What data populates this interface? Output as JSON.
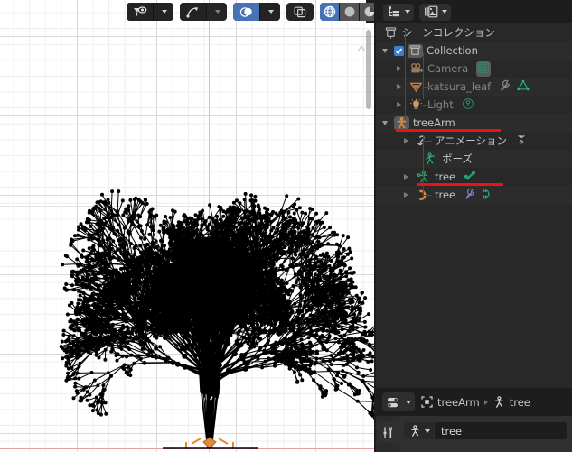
{
  "app": "blender",
  "viewport": {
    "name": "3d-viewport",
    "shading_mode": "wireframe",
    "header_groups": [
      {
        "name": "visibility-group",
        "buttons": [
          {
            "name": "object-type-visibility-icon",
            "label": "",
            "state": "normal"
          },
          {
            "name": "object-type-visibility-dropdown",
            "label": "",
            "state": "normal"
          }
        ]
      },
      {
        "name": "gizmo-group",
        "buttons": [
          {
            "name": "show-gizmo-icon",
            "label": "",
            "state": "normal"
          },
          {
            "name": "gizmo-dropdown",
            "label": "",
            "state": "disabled"
          }
        ]
      },
      {
        "name": "overlay-group",
        "buttons": [
          {
            "name": "show-overlays-icon",
            "label": "",
            "state": "active"
          },
          {
            "name": "overlays-dropdown",
            "label": "",
            "state": "normal"
          }
        ]
      },
      {
        "name": "xray-group",
        "buttons": [
          {
            "name": "toggle-xray-icon",
            "label": "",
            "state": "normal"
          }
        ]
      },
      {
        "name": "shading-group",
        "buttons": [
          {
            "name": "shading-wireframe-icon",
            "label": "",
            "state": "active"
          },
          {
            "name": "shading-solid-icon",
            "label": "",
            "state": "normal"
          },
          {
            "name": "shading-material-preview-icon",
            "label": "",
            "state": "normal"
          },
          {
            "name": "shading-rendered-icon",
            "label": "",
            "state": "normal"
          },
          {
            "name": "shading-dropdown",
            "label": "",
            "state": "normal"
          }
        ]
      }
    ],
    "axis_colors": {
      "z_axis": "#b6cde0",
      "x_axis": "#e6a2a2"
    },
    "background": "#ffffff",
    "grid_minor": "#eeeeee",
    "grid_major": "#d8d8d8",
    "object_color": "#000000",
    "bone_origin_color": "#e08a3c"
  },
  "outliner": {
    "name": "outliner-editor",
    "header": {
      "editor_type": "outliner",
      "display_mode": "view-layer"
    },
    "rows": [
      {
        "id": "scene-collection",
        "label": "シーンコレクション",
        "indent": 8,
        "icon": "scene-collection-icon",
        "icon_color": "#b9b9b9",
        "disclosure": "none",
        "checkbox": false,
        "dim": false,
        "stripe": false,
        "trail": []
      },
      {
        "id": "collection",
        "label": "Collection",
        "indent": 20,
        "icon": "collection-icon",
        "icon_color": "#b9b9b9",
        "disclosure": "open",
        "checkbox": true,
        "dim": false,
        "stripe": true,
        "selected_icon": true,
        "trail": []
      },
      {
        "id": "camera",
        "label": "Camera",
        "indent": 36,
        "icon": "camera-object-icon",
        "icon_color": "#9b7b5a",
        "disclosure": "closed",
        "checkbox": false,
        "dim": true,
        "stripe": false,
        "trail": [
          {
            "name": "camera-data-icon",
            "color": "#3a7f6e",
            "glyph": "camera-data",
            "boxed": true
          }
        ]
      },
      {
        "id": "katsura-leaf",
        "label": "katsura_leaf",
        "indent": 36,
        "icon": "mesh-object-icon",
        "icon_color": "#c07a3e",
        "disclosure": "closed",
        "checkbox": false,
        "dim": true,
        "stripe": true,
        "trail": [
          {
            "name": "modifier-wrench-icon",
            "color": "#8a8a8a",
            "glyph": "wrench"
          },
          {
            "name": "mesh-data-icon",
            "color": "#2cb48a",
            "glyph": "mesh-data"
          }
        ]
      },
      {
        "id": "light",
        "label": "Light",
        "indent": 36,
        "icon": "light-object-icon",
        "icon_color": "#c79a62",
        "disclosure": "closed",
        "checkbox": false,
        "dim": true,
        "stripe": false,
        "trail": [
          {
            "name": "light-data-icon",
            "color": "#2c8f6e",
            "glyph": "light-data"
          }
        ]
      },
      {
        "id": "tree-arm",
        "label": "treeArm",
        "indent": 20,
        "icon": "armature-object-icon",
        "icon_color": "#e08a3c",
        "disclosure": "open",
        "checkbox": false,
        "dim": false,
        "stripe": true,
        "selected_icon": true,
        "annotated": true,
        "annotation_color": "#ee1111",
        "trail": []
      },
      {
        "id": "animation",
        "label": "アニメーション",
        "indent": 44,
        "icon": "animation-icon",
        "icon_color": "#b9b9b9",
        "disclosure": "closed",
        "checkbox": false,
        "dim": false,
        "stripe": false,
        "trail": [
          {
            "name": "action-icon",
            "color": "#b9b9b9",
            "glyph": "action"
          }
        ]
      },
      {
        "id": "pose",
        "label": "ポーズ",
        "indent": 52,
        "icon": "pose-icon",
        "icon_color": "#29b36e",
        "disclosure": "none",
        "checkbox": false,
        "dim": false,
        "stripe": true,
        "trail": []
      },
      {
        "id": "armature-data-tree",
        "label": "tree",
        "indent": 44,
        "icon": "armature-data-icon",
        "icon_color": "#29b36e",
        "disclosure": "closed",
        "checkbox": false,
        "dim": false,
        "stripe": false,
        "annotated": true,
        "annotation_color": "#ee1111",
        "trail": [
          {
            "name": "bone-icon",
            "color": "#1fa86a",
            "glyph": "bone"
          }
        ]
      },
      {
        "id": "curve-object-tree",
        "label": "tree",
        "indent": 44,
        "icon": "curve-object-icon",
        "icon_color": "#d4874a",
        "disclosure": "closed",
        "checkbox": false,
        "dim": false,
        "stripe": true,
        "trail": [
          {
            "name": "modifier-wrench-icon",
            "color": "#7a86c8",
            "glyph": "wrench"
          },
          {
            "name": "curve-data-icon",
            "color": "#2cb48a",
            "glyph": "curve-data"
          }
        ]
      }
    ]
  },
  "properties": {
    "name": "properties-editor",
    "header": {
      "editor_type_label": "properties",
      "breadcrumb": [
        {
          "name": "breadcrumb-object",
          "label": "treeArm",
          "icon": "object-icon"
        },
        {
          "name": "breadcrumb-data",
          "label": "tree",
          "icon": "armature-data-icon"
        }
      ]
    },
    "tabs": [
      {
        "name": "tab-tool",
        "label": "",
        "icon": "tool-icon",
        "active": true
      }
    ],
    "datablock": {
      "name": "armature-datablock",
      "icon": "armature-data-icon",
      "value": "tree"
    }
  }
}
